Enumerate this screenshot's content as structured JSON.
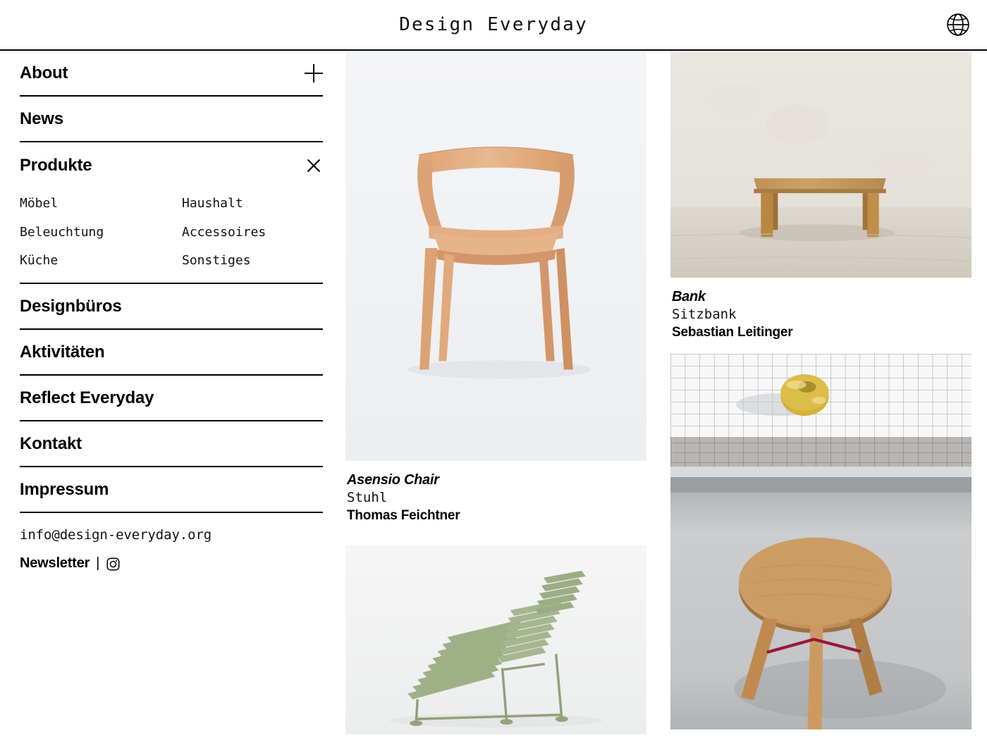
{
  "header": {
    "title": "Design Everyday",
    "globe_icon": "globe-icon"
  },
  "sidebar": {
    "nav": [
      {
        "label": "About",
        "toggle": "plus",
        "expanded": false
      },
      {
        "label": "News",
        "toggle": null,
        "expanded": false
      },
      {
        "label": "Produkte",
        "toggle": "close",
        "expanded": true,
        "subitems": [
          "Möbel",
          "Haushalt",
          "Beleuchtung",
          "Accessoires",
          "Küche",
          "Sonstiges"
        ]
      },
      {
        "label": "Designbüros",
        "toggle": null,
        "expanded": false
      },
      {
        "label": "Aktivitäten",
        "toggle": null,
        "expanded": false
      },
      {
        "label": "Reflect Everyday",
        "toggle": null,
        "expanded": false
      },
      {
        "label": "Kontakt",
        "toggle": null,
        "expanded": false
      },
      {
        "label": "Impressum",
        "toggle": null,
        "expanded": false
      }
    ],
    "contact": {
      "email": "info@design-everyday.org",
      "newsletter_label": "Newsletter",
      "separator": "|",
      "instagram_icon": "instagram-icon"
    }
  },
  "gallery": {
    "left_column": [
      {
        "image_alt": "wooden-armchair",
        "title": "Asensio Chair",
        "type": "Stuhl",
        "designer": "Thomas Feichtner"
      },
      {
        "image_alt": "green-slatted-bench",
        "title": "",
        "type": "",
        "designer": ""
      }
    ],
    "right_column": [
      {
        "image_alt": "wooden-bench",
        "title": "Bank",
        "type": "Sitzbank",
        "designer": "Sebastian Leitinger"
      },
      {
        "image_alt": "yellow-ceramic-donut-on-grid",
        "title": "",
        "type": "",
        "designer": ""
      },
      {
        "image_alt": "round-wooden-stool",
        "title": "",
        "type": "",
        "designer": ""
      }
    ]
  },
  "colors": {
    "text": "#000000",
    "background": "#ffffff",
    "rule": "#000000",
    "wood": "#d89a6c",
    "sage_green": "#9aab81",
    "mustard_yellow": "#d8b53a"
  }
}
